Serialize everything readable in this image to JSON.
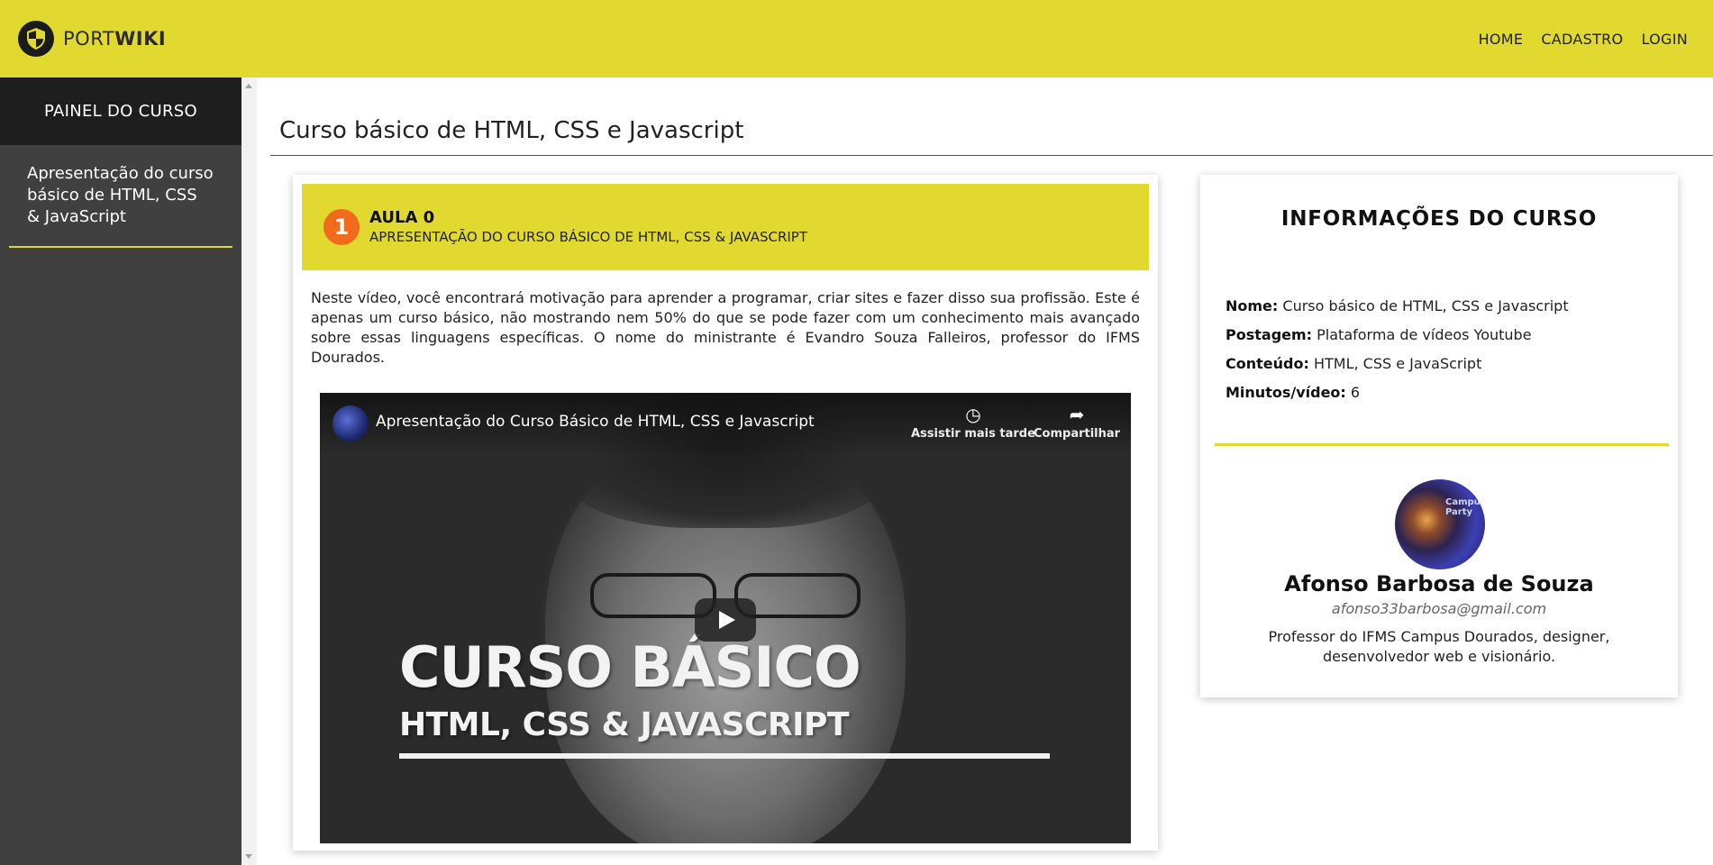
{
  "header": {
    "brand_light": "PORT",
    "brand_bold": "WIKI",
    "nav": [
      "HOME",
      "CADASTRO",
      "LOGIN"
    ],
    "accent_color": "#e1d830"
  },
  "sidebar": {
    "heading": "PAINEL DO CURSO",
    "items": [
      {
        "label": "Apresentação do curso básico de HTML, CSS & JavaScript"
      }
    ]
  },
  "main": {
    "title": "Curso básico de HTML, CSS e Javascript",
    "lesson": {
      "number": "1",
      "title": "AULA 0",
      "subtitle": "APRESENTAÇÃO DO CURSO BÁSICO DE HTML, CSS & JAVASCRIPT",
      "description": "Neste vídeo, você encontrará motivação para aprender a programar, criar sites e fazer disso sua profissão. Este é apenas um curso básico, não mostrando nem 50% do que se pode fazer com um conhecimento mais avançado sobre essas linguagens específicas. O nome do ministrante é Evandro Souza Falleiros, professor do IFMS Dourados.",
      "number_color": "#f26a1b"
    },
    "video": {
      "title": "Apresentação do Curso Básico de HTML, CSS e Javascript",
      "watch_later": "Assistir mais tarde",
      "share": "Compartilhar",
      "overlay_line1": "CURSO BÁSICO",
      "overlay_line2": "HTML, CSS & JAVASCRIPT"
    }
  },
  "info": {
    "title": "INFORMAÇÕES DO CURSO",
    "fields": [
      {
        "label": "Nome:",
        "value": "Curso básico de HTML, CSS e Javascript"
      },
      {
        "label": "Postagem:",
        "value": "Plataforma de vídeos Youtube"
      },
      {
        "label": "Conteúdo:",
        "value": "HTML, CSS e JavaScript"
      },
      {
        "label": "Minutos/vídeo:",
        "value": "6"
      }
    ],
    "author": {
      "name": "Afonso Barbosa de Souza",
      "email": "afonso33barbosa@gmail.com",
      "bio": "Professor do IFMS Campus Dourados, designer, desenvolvedor web e visionário.",
      "avatar_text": "Campus Party"
    }
  }
}
